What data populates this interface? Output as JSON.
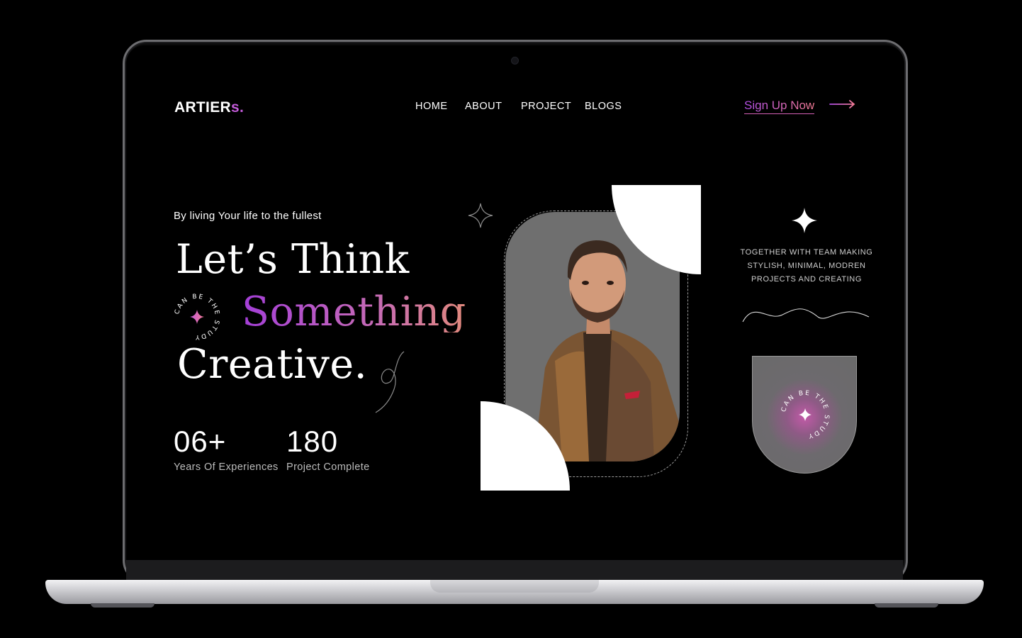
{
  "nav": {
    "logo_main": "ARTIER",
    "logo_accent": "s.",
    "links": [
      "HOME",
      "ABOUT",
      "PROJECT",
      "BLOGS"
    ],
    "cta": "Sign Up Now",
    "cta_icon": "arrow-right-icon"
  },
  "hero": {
    "tagline": "By living Your life to the fullest",
    "line1": "Let’s Think",
    "line2": "Something",
    "line3": "Creative.",
    "badge_text": "CAN BE THE STUDY"
  },
  "stats": [
    {
      "value": "06+",
      "label": "Years Of Experiences"
    },
    {
      "value": "180",
      "label": "Project Complete"
    }
  ],
  "side": {
    "text_lines": [
      "TOGETHER WITH TEAM MAKING",
      "STYLISH, MINIMAL, MODREN",
      "PROJECTS AND CREATING"
    ],
    "badge_text": "CAN BE THE STUDY"
  },
  "colors": {
    "accent_purple": "#a43fd8",
    "accent_pink": "#e1897c",
    "background": "#000000"
  }
}
